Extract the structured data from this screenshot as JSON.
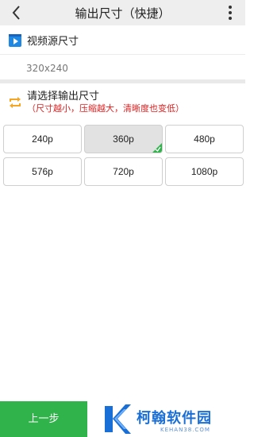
{
  "header": {
    "title": "输出尺寸（快捷）",
    "back_icon": "chevron-left-icon",
    "menu_icon": "more-vertical-icon"
  },
  "source": {
    "icon": "video-play-icon",
    "label": "视频源尺寸",
    "value": "320x240"
  },
  "output": {
    "icon": "swap-arrows-icon",
    "label": "请选择输出尺寸",
    "hint": "（尺寸越小，压缩越大，清晰度也变低）"
  },
  "sizes": [
    {
      "label": "240p",
      "selected": false
    },
    {
      "label": "360p",
      "selected": true
    },
    {
      "label": "480p",
      "selected": false
    },
    {
      "label": "576p",
      "selected": false
    },
    {
      "label": "720p",
      "selected": false
    },
    {
      "label": "1080p",
      "selected": false
    }
  ],
  "footer": {
    "prev_label": "上一步"
  },
  "watermark": {
    "name": "柯翰软件园",
    "url": "KEHAN38.COM"
  },
  "colors": {
    "accent_green": "#2fb34a",
    "hint_red": "#e02020",
    "icon_blue": "#1e88e5",
    "icon_orange": "#f5a623",
    "watermark_blue": "#1a6fd6"
  }
}
